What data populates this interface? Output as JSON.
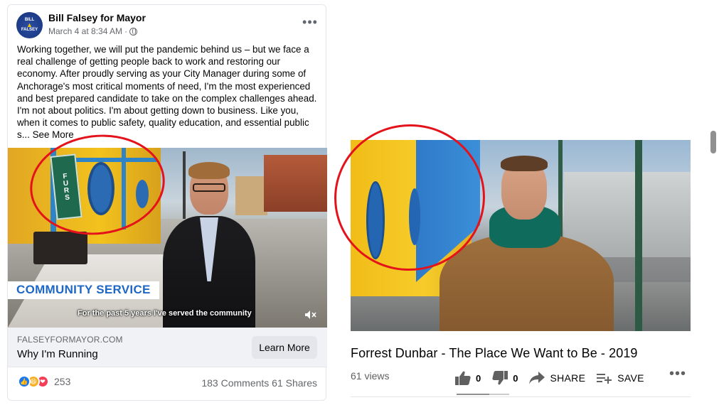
{
  "facebook_post": {
    "page_name": "Bill Falsey for Mayor",
    "avatar_text": [
      "BILL",
      "FALSEY"
    ],
    "date": "March 4 at 8:34 AM",
    "separator": "·",
    "body": "Working together, we will put the pandemic behind us – but we face a real challenge of getting people back to work and restoring our economy. After proudly serving as your City Manager during some of Anchorage's most critical moments of need, I'm the most experienced and best prepared candidate to take on the complex challenges ahead. I'm not about politics. I'm about getting down to business. Like you, when it comes to public safety, quality education, and essential public s...",
    "see_more": "See More",
    "video": {
      "overlay_label": "COMMUNITY SERVICE",
      "caption": "For the past 5 years I've served the community",
      "sign_text": "FURS"
    },
    "link": {
      "domain": "FALSEYFORMAYOR.COM",
      "title": "Why I'm Running",
      "cta": "Learn More"
    },
    "reactions": {
      "count": "253",
      "types": [
        "like-icon",
        "haha-icon",
        "love-icon"
      ]
    },
    "stats": "183 Comments  61 Shares"
  },
  "youtube": {
    "title": "Forrest Dunbar - The Place We Want to Be - 2019",
    "views": "61 views",
    "likes": "0",
    "dislikes": "0",
    "share_label": "SHARE",
    "save_label": "SAVE",
    "more": "•••"
  },
  "colors": {
    "annotation_red": "#e3121b",
    "fb_blue": "#1877f2",
    "community_label_blue": "#1e67c5"
  }
}
